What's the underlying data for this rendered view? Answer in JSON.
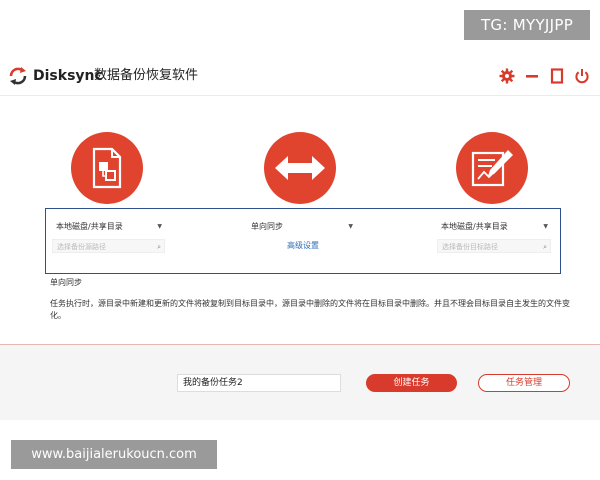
{
  "watermarks": {
    "top_right": "TG: MYYJJPP",
    "bottom_left": "www.baijialerukoucn.com"
  },
  "titlebar": {
    "brand": "Disksync",
    "title": "数据备份恢复软件",
    "icons": [
      "refresh-logo-icon",
      "gear-icon",
      "minimize-icon",
      "restore-icon",
      "power-icon"
    ]
  },
  "source": {
    "icon": "file-copy-icon",
    "type_select": "本地磁盘/共享目录",
    "path_placeholder": "选择备份源路径"
  },
  "sync": {
    "icon": "double-arrow-icon",
    "mode_select": "单向同步",
    "advanced_link": "高级设置"
  },
  "target": {
    "icon": "edit-document-icon",
    "type_select": "本地磁盘/共享目录",
    "path_placeholder": "选择备份目标路径"
  },
  "description": {
    "mode_label": "单向同步",
    "text": "任务执行时，源目录中新建和更新的文件将被复制到目标目录中，源目录中删除的文件将在目标目录中删除。并且不理会目标目录自主发生的文件变化。"
  },
  "footer": {
    "task_name_value": "我的备份任务2",
    "create_button": "创建任务",
    "manage_button": "任务管理"
  },
  "colors": {
    "accent": "#e0442f",
    "button_red": "#d83a2c",
    "link_blue": "#2e6db5",
    "box_border": "#2f4f8f"
  }
}
